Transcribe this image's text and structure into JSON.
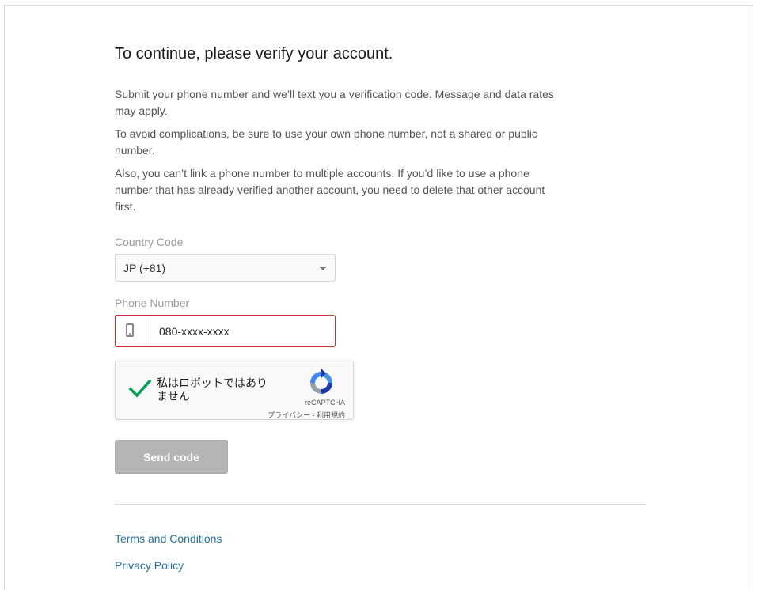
{
  "page": {
    "title": "To continue, please verify your account.",
    "paragraphs": [
      "Submit your phone number and we’ll text you a verification code. Message and data rates may apply.",
      "To avoid complications, be sure to use your own phone number, not a shared or public number.",
      "Also, you can’t link a phone number to multiple accounts. If you’d like to use a phone number that has already verified another account, you need to delete that other account first."
    ]
  },
  "form": {
    "country_code_label": "Country Code",
    "country_code_value": "JP (+81)",
    "phone_label": "Phone Number",
    "phone_value": "080-xxxx-xxxx",
    "phone_icon": "mobile-phone-icon",
    "send_button": "Send code"
  },
  "recaptcha": {
    "label": "私はロボットではありません",
    "checked": true,
    "check_color": "#009e55",
    "brand": "reCAPTCHA",
    "privacy": "プライバシー",
    "separator": " - ",
    "terms": "利用規約"
  },
  "footer": {
    "links": [
      "Terms and Conditions",
      "Privacy Policy"
    ]
  },
  "colors": {
    "error_border": "#c9302c",
    "link": "#2a6f97",
    "button_disabled": "#b5b5b5"
  }
}
